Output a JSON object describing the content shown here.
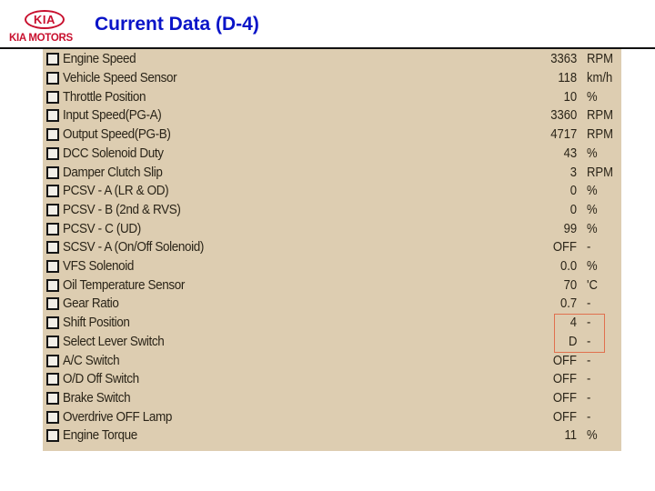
{
  "header": {
    "logo_mark": "KIA",
    "logo_text": "KIA MOTORS",
    "title": "Current Data (D-4)"
  },
  "colors": {
    "title": "#0a14c8",
    "brand": "#c8102e",
    "panel_bg": "#ddcdb1",
    "highlight_border": "#e0704e"
  },
  "data_list": {
    "items": [
      {
        "label": "Engine Speed",
        "value": "3363",
        "unit": "RPM",
        "checked": false
      },
      {
        "label": "Vehicle Speed Sensor",
        "value": "118",
        "unit": "km/h",
        "checked": false
      },
      {
        "label": "Throttle Position",
        "value": "10",
        "unit": "%",
        "checked": false
      },
      {
        "label": "Input Speed(PG-A)",
        "value": "3360",
        "unit": "RPM",
        "checked": false
      },
      {
        "label": "Output Speed(PG-B)",
        "value": "4717",
        "unit": "RPM",
        "checked": false
      },
      {
        "label": "DCC Solenoid Duty",
        "value": "43",
        "unit": "%",
        "checked": false
      },
      {
        "label": "Damper Clutch Slip",
        "value": "3",
        "unit": "RPM",
        "checked": false
      },
      {
        "label": "PCSV - A (LR & OD)",
        "value": "0",
        "unit": "%",
        "checked": false
      },
      {
        "label": "PCSV - B (2nd & RVS)",
        "value": "0",
        "unit": "%",
        "checked": false
      },
      {
        "label": "PCSV - C (UD)",
        "value": "99",
        "unit": "%",
        "checked": false
      },
      {
        "label": "SCSV - A (On/Off Solenoid)",
        "value": "OFF",
        "unit": "-",
        "checked": false
      },
      {
        "label": "VFS Solenoid",
        "value": "0.0",
        "unit": "%",
        "checked": false
      },
      {
        "label": "Oil Temperature Sensor",
        "value": "70",
        "unit": "'C",
        "checked": false
      },
      {
        "label": "Gear Ratio",
        "value": "0.7",
        "unit": "-",
        "checked": false
      },
      {
        "label": "Shift Position",
        "value": "4",
        "unit": "-",
        "checked": false,
        "highlighted": true
      },
      {
        "label": "Select Lever Switch",
        "value": "D",
        "unit": "-",
        "checked": false,
        "highlighted": true
      },
      {
        "label": "A/C Switch",
        "value": "OFF",
        "unit": "-",
        "checked": false
      },
      {
        "label": "O/D Off Switch",
        "value": "OFF",
        "unit": "-",
        "checked": false
      },
      {
        "label": "Brake Switch",
        "value": "OFF",
        "unit": "-",
        "checked": false
      },
      {
        "label": "Overdrive OFF Lamp",
        "value": "OFF",
        "unit": "-",
        "checked": false
      },
      {
        "label": "Engine Torque",
        "value": "11",
        "unit": "%",
        "checked": false
      }
    ]
  }
}
